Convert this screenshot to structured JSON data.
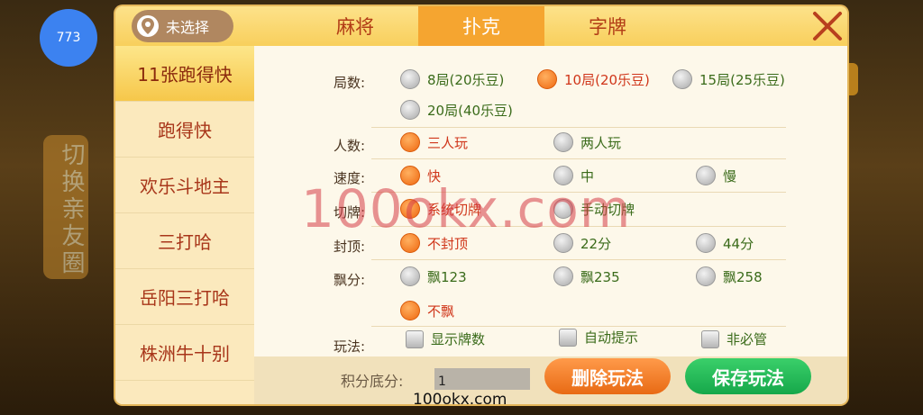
{
  "user": {
    "avatar_text": "773"
  },
  "background": {
    "side_banner": "切换亲友圈"
  },
  "location": {
    "label": "未选择"
  },
  "tabs": [
    {
      "label": "麻将",
      "active": false
    },
    {
      "label": "扑克",
      "active": true
    },
    {
      "label": "字牌",
      "active": false
    }
  ],
  "sidebar": {
    "items": [
      {
        "label": "11张跑得快",
        "active": true
      },
      {
        "label": "跑得快",
        "active": false
      },
      {
        "label": "欢乐斗地主",
        "active": false
      },
      {
        "label": "三打哈",
        "active": false
      },
      {
        "label": "岳阳三打哈",
        "active": false
      },
      {
        "label": "株洲牛十别",
        "active": false
      }
    ]
  },
  "options": {
    "rounds": {
      "label": "局数:",
      "choices": [
        "8局(20乐豆)",
        "10局(20乐豆)",
        "15局(25乐豆)",
        "20局(40乐豆)"
      ],
      "selected": "10局(20乐豆)"
    },
    "players": {
      "label": "人数:",
      "choices": [
        "三人玩",
        "两人玩"
      ],
      "selected": "三人玩"
    },
    "speed": {
      "label": "速度:",
      "choices": [
        "快",
        "中",
        "慢"
      ],
      "selected": "快"
    },
    "cut": {
      "label": "切牌:",
      "choices": [
        "系统切牌",
        "手动切牌"
      ],
      "selected": "系统切牌"
    },
    "cap": {
      "label": "封顶:",
      "choices": [
        "不封顶",
        "22分",
        "44分"
      ],
      "selected": "不封顶"
    },
    "float": {
      "label": "飘分:",
      "choices": [
        "飘123",
        "飘235",
        "飘258",
        "不飘"
      ],
      "selected": "不飘"
    },
    "play": {
      "label": "玩法:",
      "choices": [
        "显示牌数",
        "自动提示",
        "非必管"
      ]
    }
  },
  "bottom": {
    "score_label": "积分底分:",
    "score_value": "1",
    "delete_label": "删除玩法",
    "save_label": "保存玩法"
  },
  "watermark": {
    "center": "100okx.com",
    "bottom": "100okx.com"
  },
  "colors": {
    "accent": "#f5a530",
    "selected": "#ef6810",
    "save": "#16a84a"
  }
}
